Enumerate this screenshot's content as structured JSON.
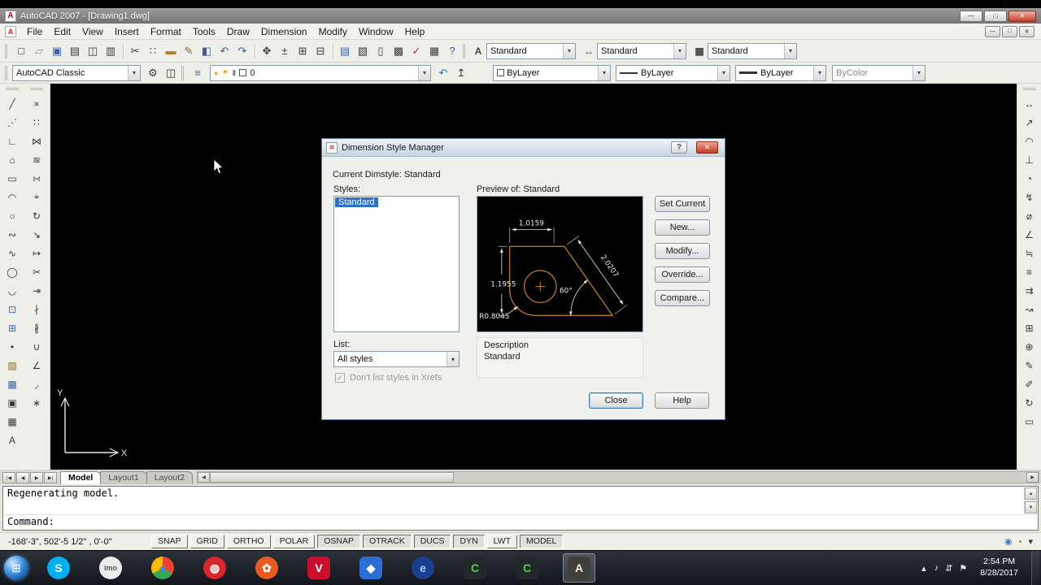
{
  "titlebar": {
    "title": "AutoCAD 2007 - [Drawing1.dwg]",
    "app_icon": "A",
    "buttons": [
      {
        "name": "minimize-button",
        "glyph": "—"
      },
      {
        "name": "maximize-button",
        "glyph": "□"
      },
      {
        "name": "close-button",
        "glyph": "✕"
      }
    ]
  },
  "menubar": {
    "file_icon": "A",
    "items": [
      "File",
      "Edit",
      "View",
      "Insert",
      "Format",
      "Tools",
      "Draw",
      "Dimension",
      "Modify",
      "Window",
      "Help"
    ],
    "window_buttons": [
      {
        "name": "mdi-minimize-button",
        "glyph": "—"
      },
      {
        "name": "mdi-restore-button",
        "glyph": "□"
      },
      {
        "name": "mdi-close-button",
        "glyph": "✕"
      }
    ]
  },
  "standard_toolbar": {
    "icons": [
      {
        "name": "qnew-icon",
        "glyph": "□"
      },
      {
        "name": "open-icon",
        "glyph": "▱",
        "color": "#c09035"
      },
      {
        "name": "save-icon",
        "glyph": "▣",
        "color": "#3a5fa8"
      },
      {
        "name": "plot-icon",
        "glyph": "▤"
      },
      {
        "name": "plot-preview-icon",
        "glyph": "◫"
      },
      {
        "name": "publish-icon",
        "glyph": "▥"
      },
      {
        "name": "sep-1",
        "sep": true,
        "glyph": ""
      },
      {
        "name": "cut-icon",
        "glyph": "✂"
      },
      {
        "name": "copy-clip-icon",
        "glyph": "∷"
      },
      {
        "name": "paste-icon",
        "glyph": "▬",
        "color": "#b08030"
      },
      {
        "name": "match-properties-icon",
        "glyph": "✎",
        "color": "#8a6a2a"
      },
      {
        "name": "block-editor-icon",
        "glyph": "◧",
        "color": "#3a5fa8"
      },
      {
        "name": "undo-icon",
        "glyph": "↶",
        "color": "#2e5fa3"
      },
      {
        "name": "redo-icon",
        "glyph": "↷",
        "color": "#2e5fa3"
      },
      {
        "name": "sep-2",
        "sep": true,
        "glyph": ""
      },
      {
        "name": "pan-realtime-icon",
        "glyph": "✥"
      },
      {
        "name": "zoom-realtime-icon",
        "glyph": "±"
      },
      {
        "name": "zoom-window-icon",
        "glyph": "⊞"
      },
      {
        "name": "zoom-previous-icon",
        "glyph": "⊟"
      },
      {
        "name": "sep-3",
        "sep": true,
        "glyph": ""
      },
      {
        "name": "properties-icon",
        "glyph": "▤",
        "color": "#3a5fa8"
      },
      {
        "name": "designcenter-icon",
        "glyph": "▧"
      },
      {
        "name": "tool-palettes-icon",
        "glyph": "▯"
      },
      {
        "name": "sheet-set-manager-icon",
        "glyph": "▩"
      },
      {
        "name": "markup-set-manager-icon",
        "glyph": "✓",
        "color": "#a03030"
      },
      {
        "name": "quickcalc-icon",
        "glyph": "▦"
      },
      {
        "name": "help-icon",
        "glyph": "?",
        "color": "#2e5fa3"
      }
    ]
  },
  "styles_toolbar": {
    "text_style_icon": "A",
    "text_style": "Standard",
    "dim_style_icon": "↔",
    "dim_style": "Standard",
    "table_style_icon": "▦",
    "table_style": "Standard"
  },
  "workspace_toolbar": {
    "value": "AutoCAD Classic",
    "icons": [
      {
        "name": "workspace-settings-icon",
        "glyph": "⚙"
      },
      {
        "name": "my-workspace-icon",
        "glyph": "◫"
      }
    ]
  },
  "layers": {
    "pre_icons": [
      {
        "name": "layer-properties-manager-icon",
        "glyph": "≡",
        "color": "#3a6aa8"
      }
    ],
    "bulb": "●",
    "sun": "☀",
    "lock": "▮",
    "value": "0",
    "post_icons": [
      {
        "name": "layer-previous-icon",
        "glyph": "↶",
        "color": "#3a6aa8"
      },
      {
        "name": "make-object-layer-current-icon",
        "glyph": "↥"
      }
    ]
  },
  "properties_toolbar": {
    "color_value": "ByLayer",
    "linetype_value": "ByLayer",
    "lineweight_value": "ByLayer",
    "plotstyle_value": "ByColor"
  },
  "draw_toolbar": {
    "icons": [
      {
        "name": "line-icon",
        "glyph": "╱"
      },
      {
        "name": "construction-line-icon",
        "glyph": "⋰"
      },
      {
        "name": "polyline-icon",
        "glyph": "∟"
      },
      {
        "name": "polygon-icon",
        "glyph": "⌂"
      },
      {
        "name": "rectangle-icon",
        "glyph": "▭"
      },
      {
        "name": "arc-icon",
        "glyph": "◠"
      },
      {
        "name": "circle-icon",
        "glyph": "○"
      },
      {
        "name": "revision-cloud-icon",
        "glyph": "∾"
      },
      {
        "name": "spline-icon",
        "glyph": "∿"
      },
      {
        "name": "ellipse-icon",
        "glyph": "◯"
      },
      {
        "name": "ellipse-arc-icon",
        "glyph": "◡"
      },
      {
        "name": "insert-block-icon",
        "glyph": "⊡",
        "color": "#3a6aa8"
      },
      {
        "name": "make-block-icon",
        "glyph": "⊞",
        "color": "#3a6aa8"
      },
      {
        "name": "point-icon",
        "glyph": "•"
      },
      {
        "name": "hatch-icon",
        "glyph": "▨",
        "color": "#8a6a2a"
      },
      {
        "name": "gradient-icon",
        "glyph": "▩",
        "color": "#3a6aa8"
      },
      {
        "name": "region-icon",
        "glyph": "▣"
      },
      {
        "name": "table-icon",
        "glyph": "▦"
      },
      {
        "name": "multiline-text-icon",
        "glyph": "A"
      }
    ]
  },
  "modify_toolbar": {
    "icons": [
      {
        "name": "erase-icon",
        "glyph": "×"
      },
      {
        "name": "copy-icon",
        "glyph": "∷"
      },
      {
        "name": "mirror-icon",
        "glyph": "⋈"
      },
      {
        "name": "offset-icon",
        "glyph": "≋"
      },
      {
        "name": "array-icon",
        "glyph": "∺"
      },
      {
        "name": "move-icon",
        "glyph": "⌖"
      },
      {
        "name": "rotate-icon",
        "glyph": "↻"
      },
      {
        "name": "scale-icon",
        "glyph": "↘"
      },
      {
        "name": "stretch-icon",
        "glyph": "↦"
      },
      {
        "name": "trim-icon",
        "glyph": "✂"
      },
      {
        "name": "extend-icon",
        "glyph": "⇥"
      },
      {
        "name": "break-at-point-icon",
        "glyph": "∤"
      },
      {
        "name": "break-icon",
        "glyph": "∦"
      },
      {
        "name": "join-icon",
        "glyph": "∪"
      },
      {
        "name": "chamfer-icon",
        "glyph": "∠"
      },
      {
        "name": "fillet-icon",
        "glyph": "◞"
      },
      {
        "name": "explode-icon",
        "glyph": "∗"
      }
    ]
  },
  "dimension_toolbar": {
    "icons": [
      {
        "name": "linear-dimension-icon",
        "glyph": "↔"
      },
      {
        "name": "aligned-dimension-icon",
        "glyph": "↗"
      },
      {
        "name": "arc-length-icon",
        "glyph": "◠"
      },
      {
        "name": "ordinate-icon",
        "glyph": "⊥"
      },
      {
        "name": "radius-dimension-icon",
        "glyph": "◔"
      },
      {
        "name": "jogged-icon",
        "glyph": "↯"
      },
      {
        "name": "diameter-dimension-icon",
        "glyph": "⌀"
      },
      {
        "name": "angular-dimension-icon",
        "glyph": "∠"
      },
      {
        "name": "quick-dimension-icon",
        "glyph": "≒"
      },
      {
        "name": "baseline-dimension-icon",
        "glyph": "≡"
      },
      {
        "name": "continue-dimension-icon",
        "glyph": "⇉"
      },
      {
        "name": "quick-leader-icon",
        "glyph": "↝"
      },
      {
        "name": "tolerance-icon",
        "glyph": "⊞"
      },
      {
        "name": "center-mark-icon",
        "glyph": "⊕"
      },
      {
        "name": "dimension-edit-icon",
        "glyph": "✎"
      },
      {
        "name": "dimension-text-edit-icon",
        "glyph": "✐"
      },
      {
        "name": "dimension-update-icon",
        "glyph": "↻"
      },
      {
        "name": "dimension-style-icon",
        "glyph": "▭"
      }
    ]
  },
  "canvas": {
    "ucs_x": "X",
    "ucs_y": "Y"
  },
  "dialog": {
    "title": "Dimension Style Manager",
    "help_glyph": "?",
    "close_glyph": "✕",
    "current_dimstyle": "Current Dimstyle: Standard",
    "styles_label": "Styles:",
    "selected_style": "Standard",
    "preview_label": "Preview of: Standard",
    "preview": {
      "dim_top": "1.0159",
      "dim_left": "1.1955",
      "dim_aligned": "2.0207",
      "dim_angle": "60°",
      "dim_radius": "R0.8045"
    },
    "side_buttons": [
      {
        "name": "set-current-button",
        "label": "Set Current"
      },
      {
        "name": "new-button",
        "label": "New..."
      },
      {
        "name": "modify-button",
        "label": "Modify..."
      },
      {
        "name": "override-button",
        "label": "Override..."
      },
      {
        "name": "compare-button",
        "label": "Compare..."
      }
    ],
    "list_label": "List:",
    "list_value": "All styles",
    "check_glyph": "✓",
    "xref_label": "Don't list styles in Xrefs",
    "description_label": "Description",
    "description_value": "Standard",
    "close_label": "Close",
    "help_label": "Help"
  },
  "tabs": {
    "nav": [
      {
        "name": "first-tab-button",
        "glyph": "|◀"
      },
      {
        "name": "prev-tab-button",
        "glyph": "◀"
      },
      {
        "name": "next-tab-button",
        "glyph": "▶"
      },
      {
        "name": "last-tab-button",
        "glyph": "▶|"
      }
    ],
    "items": [
      {
        "label": "Model",
        "active": true
      },
      {
        "label": "Layout1"
      },
      {
        "label": "Layout2"
      }
    ],
    "scroll_left": "◀",
    "scroll_right": "▶"
  },
  "command": {
    "lines": [
      "Regenerating model.",
      "Command:"
    ],
    "scroll_up": "▲",
    "scroll_down": "▼"
  },
  "statusbar": {
    "coords": "-168'-3\", 502'-5 1/2\" , 0'-0\"",
    "toggles": [
      {
        "label": "SNAP",
        "pressed": false
      },
      {
        "label": "GRID",
        "pressed": false
      },
      {
        "label": "ORTHO",
        "pressed": false
      },
      {
        "label": "POLAR",
        "pressed": false
      },
      {
        "label": "OSNAP",
        "pressed": true
      },
      {
        "label": "OTRACK",
        "pressed": true
      },
      {
        "label": "DUCS",
        "pressed": true
      },
      {
        "label": "DYN",
        "pressed": true
      },
      {
        "label": "LWT",
        "pressed": false
      },
      {
        "label": "MODEL",
        "pressed": true
      }
    ],
    "tray": [
      {
        "name": "communication-center-icon",
        "glyph": "◉",
        "color": "#3a7abf"
      },
      {
        "name": "toolbar-lock-icon",
        "glyph": "▪",
        "color": "#c89600"
      },
      {
        "name": "statusbar-menu-icon",
        "glyph": "▾",
        "color": "#333333"
      }
    ]
  },
  "taskbar": {
    "start_glyph": "⊞",
    "tray_chevron": "▴",
    "time": "2:54 PM",
    "date": "8/28/2017",
    "tray_icons": [
      {
        "name": "volume-icon",
        "glyph": "♪"
      },
      {
        "name": "network-icon",
        "glyph": "⇵"
      },
      {
        "name": "action-center-icon",
        "glyph": "⚑"
      }
    ],
    "apps": [
      {
        "name": "skype-app",
        "glyph": "S",
        "bg": "#00aff0",
        "fg": "#ffffff",
        "cls": "circle"
      },
      {
        "name": "imo-app",
        "glyph": "imo",
        "bg": "#ececec",
        "fg": "#555555",
        "cls": "circle small"
      },
      {
        "name": "chrome-app",
        "glyph": "●",
        "bg": "conic-gradient(#ea4335 0deg 120deg, #34a853 120deg 240deg, #fbbc05 240deg 360deg)",
        "fg": "#4285f4",
        "cls": "circle"
      },
      {
        "name": "red-circle-app",
        "glyph": "◍",
        "bg": "#d8262a",
        "fg": "#ffffff",
        "cls": "circle"
      },
      {
        "name": "orange-app",
        "glyph": "✿",
        "bg": "#e85a20",
        "fg": "#ffffff",
        "cls": "circle"
      },
      {
        "name": "red-v-app",
        "glyph": "V",
        "bg": "#c8102e",
        "fg": "#ffffff"
      },
      {
        "name": "blue-app",
        "glyph": "◆",
        "bg": "#2b6fd4",
        "fg": "#ffffff"
      },
      {
        "name": "internet-explorer-app",
        "glyph": "e",
        "bg": "#1b3f8f",
        "fg": "#9fd0ff",
        "cls": "circle"
      },
      {
        "name": "camtasia-app-1",
        "glyph": "C",
        "bg": "#20282a",
        "fg": "#4fd448"
      },
      {
        "name": "camtasia-app-2",
        "glyph": "C",
        "bg": "#20282a",
        "fg": "#4fd448"
      },
      {
        "name": "autocad-app",
        "glyph": "A",
        "bg": "#3f3f38",
        "fg": "#efe8d8",
        "active": true
      }
    ]
  }
}
